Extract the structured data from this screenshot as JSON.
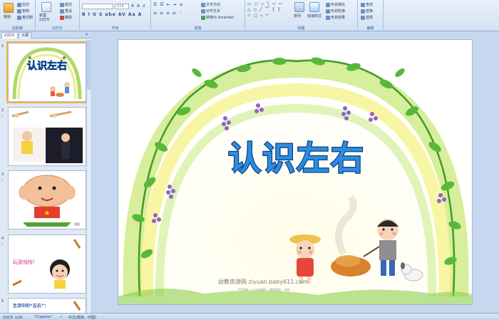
{
  "ribbon": {
    "groups": [
      {
        "label": "剪贴板"
      },
      {
        "label": "幻灯片"
      },
      {
        "label": "字体"
      },
      {
        "label": "段落"
      },
      {
        "label": "绘图"
      },
      {
        "label": "编辑"
      }
    ],
    "paste_label": "粘贴",
    "cut_label": "剪切",
    "copy_label": "复制",
    "format_painter_label": "格式刷",
    "new_slide_label": "新建\n幻灯片",
    "layout_label": "版式",
    "reset_label": "重设",
    "delete_label": "删除",
    "font_name": "",
    "font_size": "115",
    "text_direction_label": "文字方向",
    "align_text_label": "对齐文本",
    "smartart_label": "转换为 SmartArt",
    "arrange_label": "排列",
    "quick_styles_label": "快速样式",
    "shape_fill_label": "形状填充",
    "shape_outline_label": "形状轮廓",
    "shape_effects_label": "形状效果",
    "find_label": "查找",
    "replace_label": "替换",
    "select_label": "选择"
  },
  "panel": {
    "tabs": [
      {
        "label": "幻灯片"
      },
      {
        "label": "大纲"
      }
    ],
    "close": "×",
    "slides": [
      {
        "number": "1",
        "title": "认识左右"
      },
      {
        "number": "2",
        "title": ""
      },
      {
        "number": "3",
        "title": ""
      },
      {
        "number": "4",
        "title": "玩游戏啦！"
      },
      {
        "number": "5",
        "title": "生活中的“左右”："
      }
    ]
  },
  "slide": {
    "title": "认识左右",
    "watermark_main": "幼教资源网 ziyuan.baby611.com",
    "watermark_sub": "PPT课件、FLASH课件、教案随笔、试卷……"
  },
  "statusbar": {
    "slide_counter": "幻灯片 1/25",
    "theme": "\"Crayons\"",
    "language": "中文(简体，中国)"
  },
  "colors": {
    "title_fill": "#2e8de0",
    "title_stroke": "#0b3f86",
    "ribbon_bg": "#dce8f6",
    "selection": "#f2b440"
  }
}
